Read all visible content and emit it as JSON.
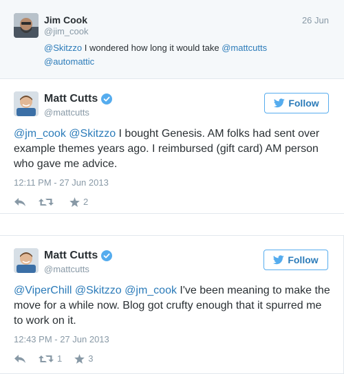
{
  "context_tweet": {
    "name": "Jim Cook",
    "handle": "@jim_cook",
    "date": "26 Jun",
    "text_parts": [
      {
        "mention": "@Skitzzo"
      },
      {
        "text": " I wondered how long it would take "
      },
      {
        "mention": "@mattcutts"
      },
      {
        "text": " "
      },
      {
        "mention": "@automattic"
      }
    ]
  },
  "tweets": [
    {
      "name": "Matt Cutts",
      "handle": "@mattcutts",
      "follow_label": "Follow",
      "text_parts": [
        {
          "mention": "@jm_cook"
        },
        {
          "text": " "
        },
        {
          "mention": "@Skitzzo"
        },
        {
          "text": " I bought Genesis. AM folks had sent over example themes years ago. I reimbursed (gift card) AM person who gave me advice."
        }
      ],
      "timestamp": "12:11 PM - 27 Jun 2013",
      "retweets": "",
      "favorites": "2"
    },
    {
      "name": "Matt Cutts",
      "handle": "@mattcutts",
      "follow_label": "Follow",
      "text_parts": [
        {
          "mention": "@ViperChill"
        },
        {
          "text": " "
        },
        {
          "mention": "@Skitzzo"
        },
        {
          "text": " "
        },
        {
          "mention": "@jm_cook"
        },
        {
          "text": " I've been meaning to make the move for a while now. Blog got crufty enough that it spurred me to work on it."
        }
      ],
      "timestamp": "12:43 PM - 27 Jun 2013",
      "retweets": "1",
      "favorites": "3"
    }
  ],
  "colors": {
    "link": "#2b7bb9",
    "follow_border": "#55acee",
    "verified": "#55acee",
    "muted": "#8899a6",
    "context_bg": "#f5f8fa"
  },
  "icons": {
    "verified": "verified-badge-icon",
    "follow": "twitter-bird-icon",
    "reply": "reply-icon",
    "retweet": "retweet-icon",
    "favorite": "star-icon"
  }
}
